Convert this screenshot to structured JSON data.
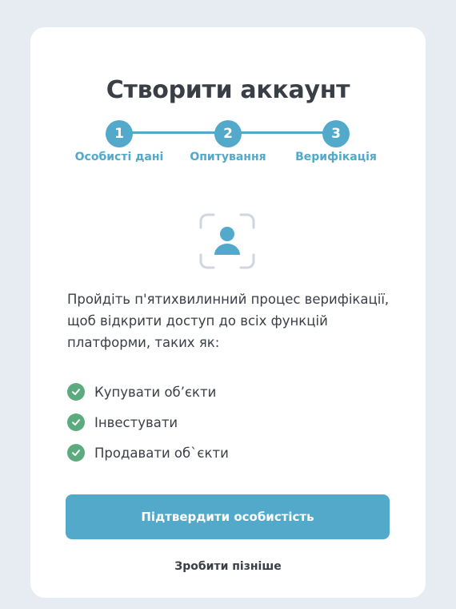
{
  "page": {
    "title": "Створити аккаунт"
  },
  "stepper": {
    "steps": [
      {
        "number": "1",
        "label": "Особисті дані"
      },
      {
        "number": "2",
        "label": "Опитування"
      },
      {
        "number": "3",
        "label": "Верифікація"
      }
    ],
    "active_color": "#52a9c9"
  },
  "verification": {
    "icon": "face-id-user-icon",
    "intro_text": "Пройдіть п'ятихвилинний процес верифікації, щоб відкрити доступ до всіх функцій платформи, таких як:",
    "features": [
      {
        "label": "Купувати об’єкти"
      },
      {
        "label": "Інвестувати"
      },
      {
        "label": "Продавати об`єкти"
      }
    ],
    "check_color": "#5cab7f"
  },
  "actions": {
    "confirm_label": "Підтвердити особистість",
    "later_label": "Зробити пізніше"
  }
}
